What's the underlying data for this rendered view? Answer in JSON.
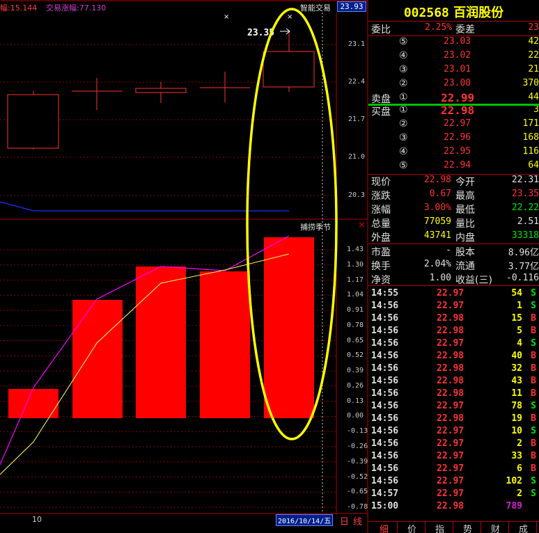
{
  "chart_header": {
    "left_label": "幅:15.144",
    "right_label": "交易涨幅:77.130",
    "indicator_name": "智能交易",
    "price_tag": "23.93",
    "peak_annotation": "23.35"
  },
  "lower_panel": {
    "indicator_name": "捕捞季节",
    "close_icon": "×"
  },
  "x_axis": {
    "left_tick": "10",
    "date": "2016/10/14/五"
  },
  "bottom_tabs_left": [
    "日",
    "线"
  ],
  "price_axis": [
    "23.1",
    "22.4",
    "21.7",
    "21.0",
    "20.3"
  ],
  "indicator_axis": [
    "1.43",
    "1.30",
    "1.17",
    "1.04",
    "0.91",
    "0.78",
    "0.65",
    "0.52",
    "0.39",
    "0.26",
    "0.13",
    "0.00",
    "-0.13",
    "-0.26",
    "-0.39",
    "-0.52",
    "-0.65",
    "-0.78"
  ],
  "stock": {
    "code": "002568",
    "name": "百润股份"
  },
  "order_book": {
    "weibi_label": "委比",
    "weibi_value": "2.25%",
    "weicha_label": "委差",
    "weicha_value": "23",
    "sell_label": "卖盘",
    "buy_label": "买盘",
    "sells": [
      {
        "level": "⑤",
        "price": "23.03",
        "vol": "42"
      },
      {
        "level": "④",
        "price": "23.02",
        "vol": "22"
      },
      {
        "level": "③",
        "price": "23.01",
        "vol": "21"
      },
      {
        "level": "②",
        "price": "23.00",
        "vol": "370"
      },
      {
        "level": "①",
        "price": "22.99",
        "vol": "44"
      }
    ],
    "buys": [
      {
        "level": "①",
        "price": "22.98",
        "vol": "3"
      },
      {
        "level": "②",
        "price": "22.97",
        "vol": "171"
      },
      {
        "level": "③",
        "price": "22.96",
        "vol": "168"
      },
      {
        "level": "④",
        "price": "22.95",
        "vol": "116"
      },
      {
        "level": "⑤",
        "price": "22.94",
        "vol": "64"
      }
    ]
  },
  "stats": [
    {
      "l1": "现价",
      "v1": "22.98",
      "l2": "今开",
      "v2": "22.31"
    },
    {
      "l1": "涨跌",
      "v1": "0.67",
      "l2": "最高",
      "v2": "23.35"
    },
    {
      "l1": "涨幅",
      "v1": "3.00%",
      "l2": "最低",
      "v2": "22.22"
    },
    {
      "l1": "总量",
      "v1": "77059",
      "l2": "量比",
      "v2": "2.51"
    },
    {
      "l1": "外盘",
      "v1": "43741",
      "l2": "内盘",
      "v2": "33318"
    },
    {
      "l1": "市盈",
      "v1": "-",
      "l2": "股本",
      "v2": "8.96亿"
    },
    {
      "l1": "换手",
      "v1": "2.04%",
      "l2": "流通",
      "v2": "3.77亿"
    },
    {
      "l1": "净资",
      "v1": "1.00",
      "l2": "收益(三)",
      "v2": "-0.116"
    }
  ],
  "ticks": [
    {
      "time": "14:55",
      "price": "22.97",
      "vol": "54",
      "side": "S"
    },
    {
      "time": "14:56",
      "price": "22.97",
      "vol": "1",
      "side": "S"
    },
    {
      "time": "14:56",
      "price": "22.98",
      "vol": "15",
      "side": "B"
    },
    {
      "time": "14:56",
      "price": "22.98",
      "vol": "5",
      "side": "B"
    },
    {
      "time": "14:56",
      "price": "22.97",
      "vol": "4",
      "side": "S"
    },
    {
      "time": "14:56",
      "price": "22.98",
      "vol": "40",
      "side": "B"
    },
    {
      "time": "14:56",
      "price": "22.98",
      "vol": "32",
      "side": "B"
    },
    {
      "time": "14:56",
      "price": "22.98",
      "vol": "43",
      "side": "B"
    },
    {
      "time": "14:56",
      "price": "22.98",
      "vol": "11",
      "side": "B"
    },
    {
      "time": "14:56",
      "price": "22.97",
      "vol": "78",
      "side": "S"
    },
    {
      "time": "14:56",
      "price": "22.98",
      "vol": "19",
      "side": "B"
    },
    {
      "time": "14:56",
      "price": "22.97",
      "vol": "10",
      "side": "S"
    },
    {
      "time": "14:56",
      "price": "22.97",
      "vol": "2",
      "side": "B"
    },
    {
      "time": "14:56",
      "price": "22.97",
      "vol": "33",
      "side": "B"
    },
    {
      "time": "14:56",
      "price": "22.97",
      "vol": "6",
      "side": "B"
    },
    {
      "time": "14:56",
      "price": "22.97",
      "vol": "102",
      "side": "S"
    },
    {
      "time": "14:57",
      "price": "22.97",
      "vol": "2",
      "side": "S"
    },
    {
      "time": "15:00",
      "price": "22.98",
      "vol": "789",
      "side": ""
    }
  ],
  "bottom_tabs_right": [
    "细",
    "价",
    "指",
    "势",
    "财",
    "成"
  ],
  "colors": {
    "up": "#ff3232",
    "down": "#00e600",
    "volume": "#ffff00",
    "grid": "#7a0000",
    "highlight": "#ffff00"
  }
}
